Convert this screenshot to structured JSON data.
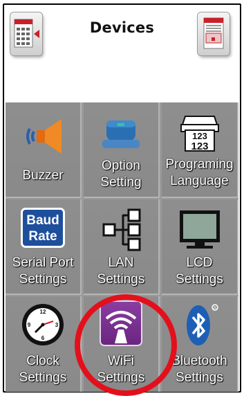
{
  "header": {
    "title": "Devices",
    "back_icon": "keypad-back-icon",
    "right_icon": "document-icon"
  },
  "tiles": [
    {
      "label": "Buzzer",
      "icon": "speaker-icon"
    },
    {
      "label": "Option Setting",
      "icon": "roller-icon"
    },
    {
      "label": "Programing Language",
      "icon": "printer-123-icon"
    },
    {
      "label": "Serial Port Settings",
      "icon": "baud-rate-icon",
      "badge": [
        "Baud",
        "Rate"
      ]
    },
    {
      "label": "LAN Settings",
      "icon": "network-tree-icon"
    },
    {
      "label": "LCD Settings",
      "icon": "monitor-icon"
    },
    {
      "label": "Clock Settings",
      "icon": "clock-icon"
    },
    {
      "label": "WiFi Settings",
      "icon": "wifi-icon"
    },
    {
      "label": "Bluetooth Settings",
      "icon": "bluetooth-icon"
    }
  ],
  "colors": {
    "highlight_circle": "#e3101c",
    "tile_bg": "#8e8e8e",
    "wifi_purple": "#7a2f8f",
    "bluetooth_blue": "#1d5fb4",
    "baud_blue": "#1e4f9c"
  }
}
